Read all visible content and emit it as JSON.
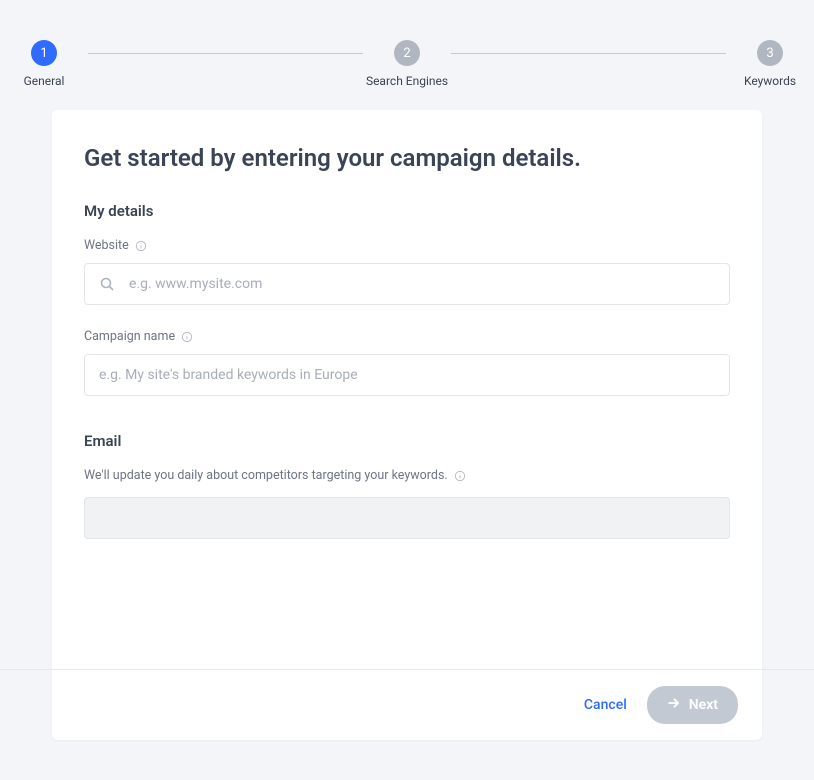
{
  "stepper": {
    "steps": [
      {
        "number": "1",
        "label": "General",
        "state": "active"
      },
      {
        "number": "2",
        "label": "Search Engines",
        "state": "inactive"
      },
      {
        "number": "3",
        "label": "Keywords",
        "state": "inactive"
      }
    ]
  },
  "main": {
    "title": "Get started by entering your campaign details.",
    "sections": {
      "details": {
        "heading": "My details",
        "fields": {
          "website": {
            "label": "Website",
            "placeholder": "e.g. www.mysite.com",
            "value": ""
          },
          "campaign_name": {
            "label": "Campaign name",
            "placeholder": "e.g. My site's branded keywords in Europe",
            "value": ""
          }
        }
      },
      "email": {
        "heading": "Email",
        "description": "We'll update you daily about competitors targeting your keywords.",
        "value": ""
      }
    }
  },
  "footer": {
    "cancel": "Cancel",
    "next": "Next"
  }
}
